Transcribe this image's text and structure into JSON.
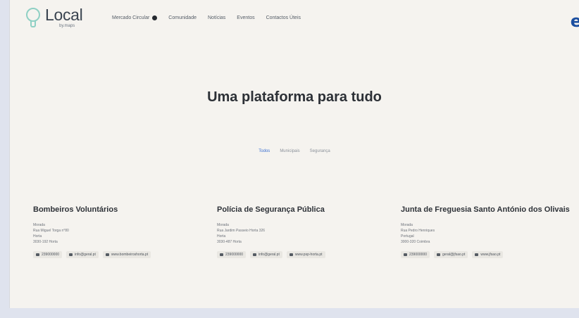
{
  "header": {
    "logo_text": "Local",
    "logo_sub": "by.maps",
    "nav": [
      {
        "label": "Mercado Circular"
      },
      {
        "label": "Comunidade"
      },
      {
        "label": "Notícias"
      },
      {
        "label": "Eventos"
      },
      {
        "label": "Contactos Úteis"
      }
    ],
    "brand_letter": "e"
  },
  "hero": {
    "title": "Uma plataforma para tudo",
    "filters": [
      {
        "label": "Todos"
      },
      {
        "label": "Municipais"
      },
      {
        "label": "Segurança"
      }
    ]
  },
  "cards": [
    {
      "title": "Bombeiros Voluntários",
      "lines": [
        "Morada",
        "Rua Miguel Torga n°80",
        "Horta",
        "3030-192 Horta"
      ],
      "badges": [
        "239000000",
        "info@geral.pt",
        "www.bombeiroshorta.pt"
      ]
    },
    {
      "title": "Polícia de Segurança Pública",
      "lines": [
        "Morada",
        "Rua Jardim Passeio Horta 326",
        "Horta",
        "3030-487 Horta"
      ],
      "badges": [
        "239000000",
        "info@geral.pt",
        "www.psp-horta.pt"
      ]
    },
    {
      "title": "Junta de Freguesia Santo António dos Olivais",
      "lines": [
        "Morada",
        "Rua Pedro Henriques",
        "Portugal",
        "3000-320 Coimbra"
      ],
      "badges": [
        "239000000",
        "geral@jfsao.pt",
        "www.jfsao.pt"
      ]
    }
  ]
}
